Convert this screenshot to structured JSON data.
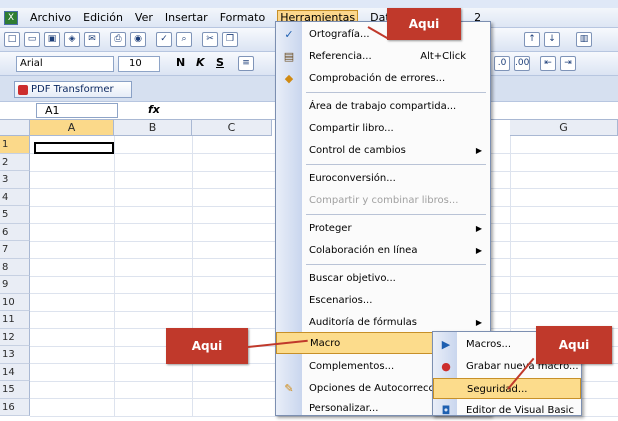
{
  "menubar": {
    "items": [
      "Archivo",
      "Edición",
      "Ver",
      "Insertar",
      "Formato",
      "Herramientas",
      "Datos",
      "2"
    ]
  },
  "toolbar": {
    "font": "Arial",
    "size": "10",
    "bold": "N",
    "italic": "K",
    "underline": "S"
  },
  "pdf": {
    "label": "PDF Transformer"
  },
  "formula": {
    "cell": "A1",
    "fx": "fx"
  },
  "sheet": {
    "columns": [
      "A",
      "B",
      "C",
      "G"
    ],
    "rows": [
      "1",
      "2",
      "3",
      "4",
      "5",
      "6",
      "7",
      "8",
      "9",
      "10",
      "11",
      "12",
      "13",
      "14",
      "15",
      "16"
    ]
  },
  "menu": {
    "items": [
      {
        "label": "Ortografía...",
        "icon": "abc"
      },
      {
        "label": "Referencia...",
        "shortcut": "Alt+Click",
        "icon": "book"
      },
      {
        "label": "Comprobación de errores...",
        "icon": "check"
      },
      {
        "label": "Área de trabajo compartida..."
      },
      {
        "label": "Compartir libro..."
      },
      {
        "label": "Control de cambios"
      },
      {
        "label": "Euroconversión..."
      },
      {
        "label": "Compartir y combinar libros..."
      },
      {
        "label": "Proteger"
      },
      {
        "label": "Colaboración en línea"
      },
      {
        "label": "Buscar objetivo..."
      },
      {
        "label": "Escenarios..."
      },
      {
        "label": "Auditoría de fórmulas"
      },
      {
        "label": "Macro"
      },
      {
        "label": "Complementos..."
      },
      {
        "label": "Opciones de Autocorrección..."
      },
      {
        "label": "Personalizar..."
      }
    ]
  },
  "submenu": {
    "items": [
      {
        "label": "Macros..."
      },
      {
        "label": "Grabar nueva macro..."
      },
      {
        "label": "Seguridad..."
      },
      {
        "label": "Editor de Visual Basic"
      }
    ]
  },
  "callouts": {
    "c1": "Aqui",
    "c2": "Aqui",
    "c3": "Aqui"
  },
  "colors": {
    "accent": "#c0392b",
    "highlight": "#fcdc8c"
  }
}
